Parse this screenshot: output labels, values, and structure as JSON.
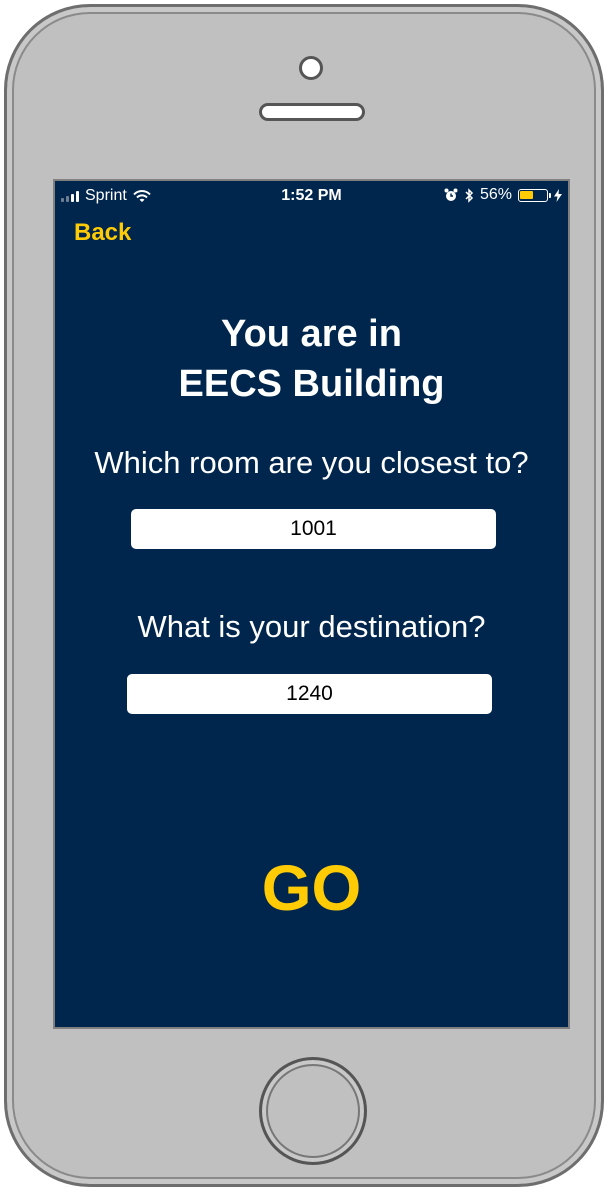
{
  "status_bar": {
    "carrier": "Sprint",
    "time": "1:52 PM",
    "battery_percent_label": "56%",
    "battery_level": 0.56,
    "icons": [
      "signal-bars-icon",
      "wifi-icon",
      "alarm-clock-icon",
      "bluetooth-icon",
      "battery-icon",
      "charging-bolt-icon"
    ]
  },
  "nav": {
    "back_label": "Back"
  },
  "main": {
    "title_line1": "You are in",
    "title_line2": "EECS Building",
    "closest_question": "Which room are you closest to?",
    "closest_value": "1001",
    "destination_question": "What is your destination?",
    "destination_value": "1240",
    "go_label": "GO"
  },
  "colors": {
    "background": "#00264d",
    "accent": "#ffcb05",
    "text": "#ffffff",
    "device": "#c0c0c0"
  }
}
